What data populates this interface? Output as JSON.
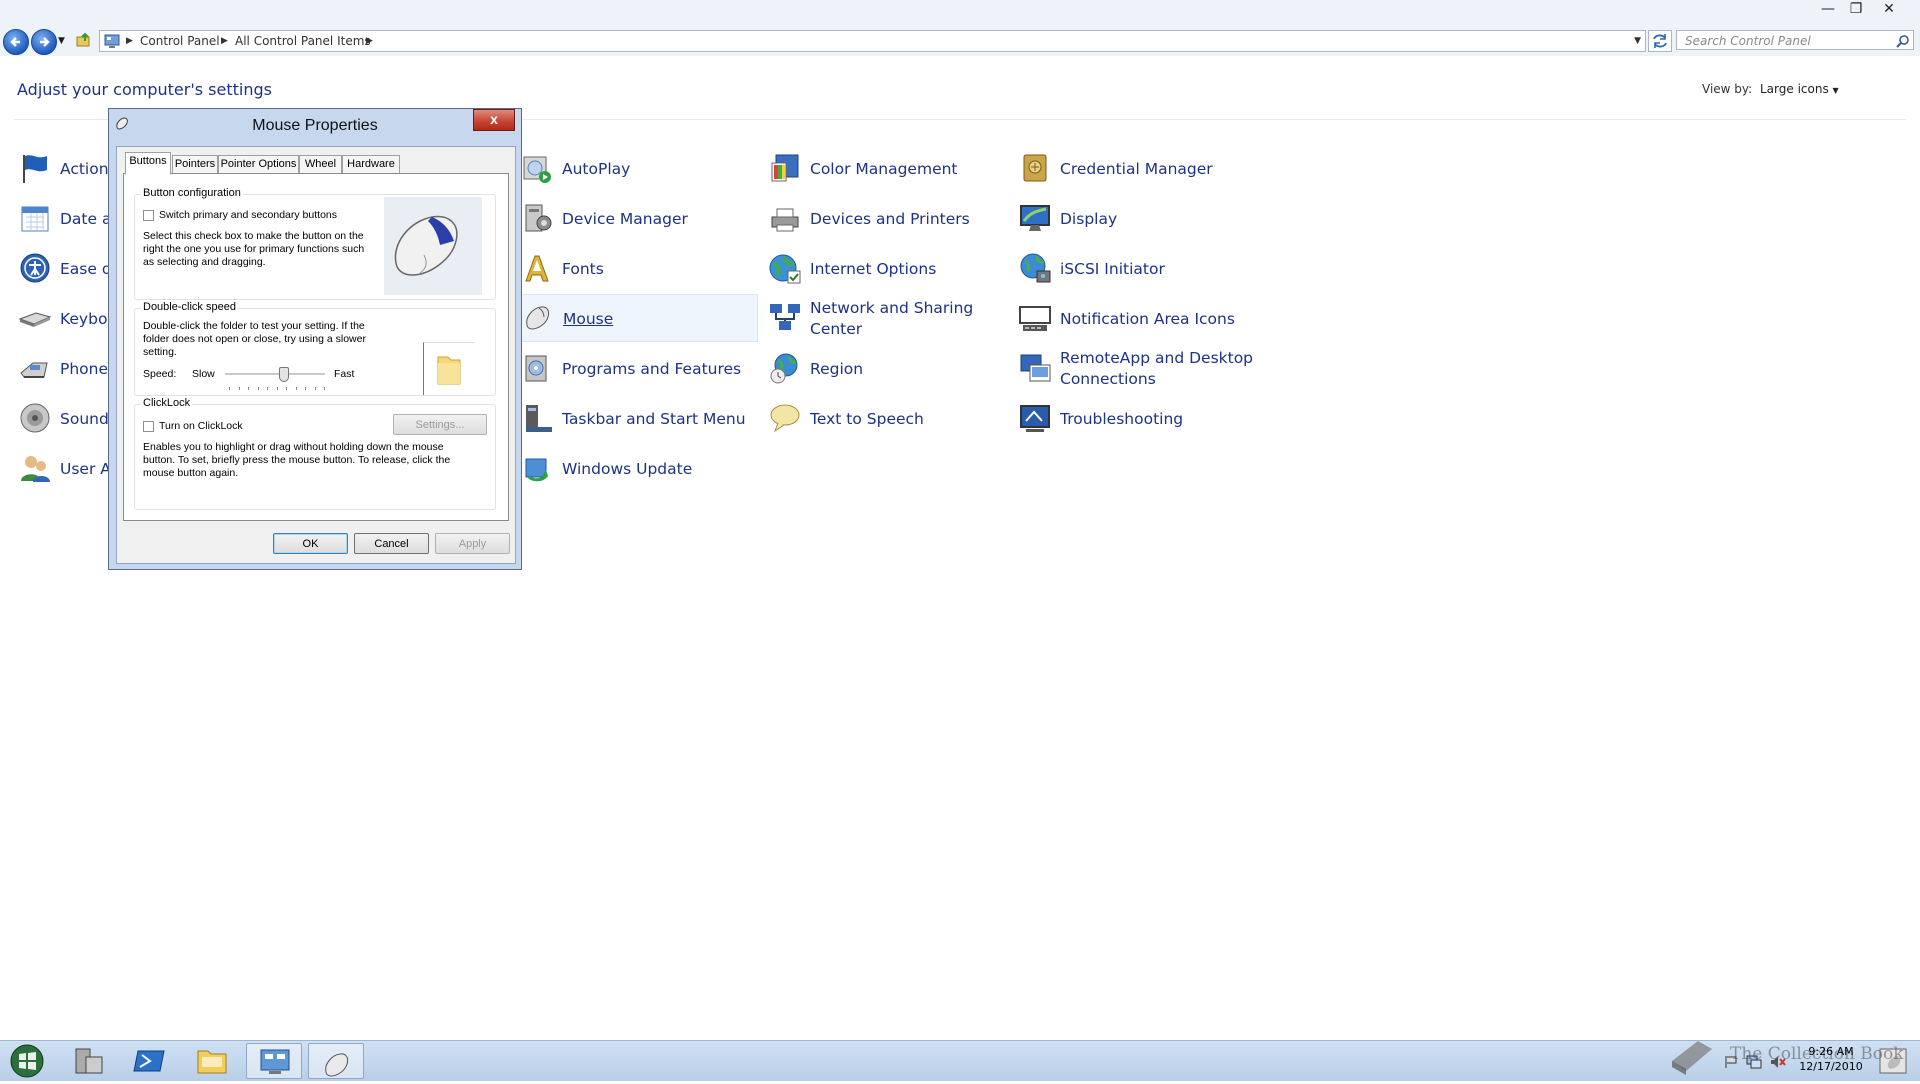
{
  "window": {
    "minimize_icon": "minimize-icon",
    "maximize_icon": "restore-icon",
    "close_icon": "close-icon"
  },
  "address_bar": {
    "crumbs": [
      "Control Panel",
      "All Control Panel Items"
    ],
    "search_placeholder": "Search Control Panel"
  },
  "header": {
    "title": "Adjust your computer's settings",
    "view_by_label": "View by:",
    "view_by_value": "Large icons"
  },
  "items": {
    "action": "Action",
    "date": "Date a",
    "ease": "Ease o",
    "keyboard": "Keybo",
    "phone": "Phone",
    "sound": "Sound",
    "user": "User A",
    "autoplay": "AutoPlay",
    "device_manager": "Device Manager",
    "fonts": "Fonts",
    "mouse": "Mouse",
    "programs": "Programs and Features",
    "taskbar": "Taskbar and Start Menu",
    "windows_update": "Windows Update",
    "color_management": "Color Management",
    "devices_printers": "Devices and Printers",
    "internet_options": "Internet Options",
    "network_line1": "Network and Sharing",
    "network_line2": "Center",
    "region": "Region",
    "text_to_speech": "Text to Speech",
    "credential_manager": "Credential Manager",
    "display": "Display",
    "iscsi": "iSCSI Initiator",
    "notification": "Notification Area Icons",
    "remoteapp_line1": "RemoteApp and Desktop",
    "remoteapp_line2": "Connections",
    "troubleshooting": "Troubleshooting"
  },
  "dialog": {
    "title": "Mouse Properties",
    "close": "x",
    "tabs": [
      "Buttons",
      "Pointers",
      "Pointer Options",
      "Wheel",
      "Hardware"
    ],
    "button_config": {
      "title": "Button configuration",
      "checkbox_label": "Switch primary and secondary buttons",
      "checked": false,
      "desc1": "Select this check box to make the button on the",
      "desc2": "right the one you use for primary functions such",
      "desc3": "as selecting and dragging."
    },
    "double_click": {
      "title": "Double-click speed",
      "desc1": "Double-click the folder to test your setting. If the",
      "desc2": "folder does not open or close, try using a slower",
      "desc3": "setting.",
      "speed_label": "Speed:",
      "slow": "Slow",
      "fast": "Fast",
      "slider_value": 0.6
    },
    "clicklock": {
      "title": "ClickLock",
      "checkbox_label": "Turn on ClickLock",
      "checked": false,
      "settings_button": "Settings...",
      "desc1": "Enables you to highlight or drag without holding down the mouse",
      "desc2": "button. To set, briefly press the mouse button. To release, click the",
      "desc3": "mouse button again."
    },
    "ok": "OK",
    "cancel": "Cancel",
    "apply": "Apply"
  },
  "taskbar": {
    "time": "9:26 AM",
    "date": "12/17/2010",
    "watermark": "The Collection Book"
  }
}
